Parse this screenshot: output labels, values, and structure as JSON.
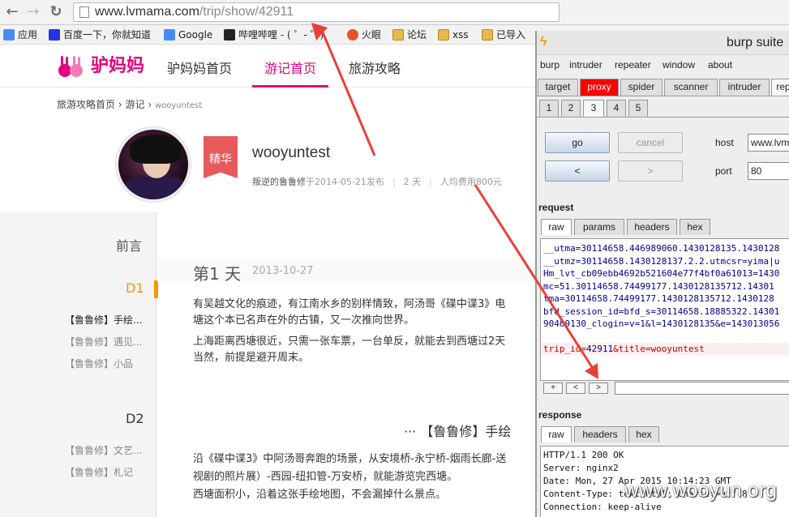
{
  "browser": {
    "url_host": "www.lvmama.com",
    "url_path": "/trip/show/42911",
    "bookmarks": [
      {
        "label": "应用",
        "icon": "apps-icon"
      },
      {
        "label": "百度一下，你就知道",
        "icon": "baidu-icon"
      },
      {
        "label": "Google",
        "icon": "google-icon"
      },
      {
        "label": "哔哩哔哩 - ( ゜- ゜)",
        "icon": "bilibili-icon"
      },
      {
        "label": "火眼",
        "icon": "fireeye-icon"
      },
      {
        "label": "论坛",
        "icon": "folder-icon"
      },
      {
        "label": "xss",
        "icon": "folder-icon"
      },
      {
        "label": "已导入",
        "icon": "folder-icon"
      }
    ]
  },
  "site": {
    "logo_text": "驴妈妈",
    "nav": [
      "驴妈妈首页",
      "游记首页",
      "旅游攻略"
    ],
    "nav_active": "游记首页",
    "breadcrumb": [
      "旅游攻略首页",
      "游记",
      "wooyuntest"
    ],
    "breadcrumb_sep": "›",
    "badge": "精华",
    "trip_title": "wooyuntest",
    "author": "叛逆的鲁鲁修",
    "published": "于2014-05-21发布",
    "days": "2 天",
    "avg_cost": "人均费用800元"
  },
  "sidebar": {
    "preface": "前言",
    "d1": "D1",
    "d1_items": [
      "【鲁鲁修】手绘...",
      "【鲁鲁修】遇见...",
      "【鲁鲁修】小品"
    ],
    "d2": "D2",
    "d2_items": [
      "【鲁鲁修】文艺...",
      "【鲁鲁修】札记"
    ]
  },
  "article": {
    "day_title": "第1 天",
    "day_date": "2013-10-27",
    "paragraphs_1": [
      "有吴越文化的痕迹，有江南水乡的别样情致，阿汤哥《碟中谍3》电",
      "塘这个本已名声在外的古镇，又一次推向世界。",
      "上海距离西塘很近，只需一张车票，一台单反，就能去到西塘过2天",
      "当然，前提是避开周末。"
    ],
    "section_title": "··· 【鲁鲁修】手绘",
    "paragraphs_2": [
      "沿《碟中谍3》中阿汤哥奔跑的场景，从安境桥-永宁桥-烟雨长廊-送",
      "视剧的照片展）-西园-纽扣管-万安桥，就能游览完西塘。",
      "西塘面积小，沿着这张手绘地图，不会漏掉什么景点。"
    ]
  },
  "burp": {
    "title": "burp suite",
    "menu": [
      "burp",
      "intruder",
      "repeater",
      "window",
      "about"
    ],
    "tabs": [
      "target",
      "proxy",
      "spider",
      "scanner",
      "intruder",
      "rep"
    ],
    "repeater_tabs": [
      "1",
      "2",
      "3",
      "4",
      "5"
    ],
    "selected_repeater_tab": "3",
    "go": "go",
    "cancel": "cancel",
    "back": "<",
    "forward": ">",
    "host_label": "host",
    "host_value": "www.lvm",
    "port_label": "port",
    "port_value": "80",
    "request_label": "request",
    "request_tabs": [
      "raw",
      "params",
      "headers",
      "hex"
    ],
    "request_lines": [
      "__utma=30114658.446989060.1430128135.1430128",
      "__utmz=30114658.1430128137.2.2.utmcsr=yima|u",
      "Hm_lvt_cb09ebb4692b521604e77f4bf0a61013=1430",
      "mc=51.30114658.74499177.1430128135712.14301",
      "tma=30114658.74499177.1430128135712.1430128",
      "bfd_session_id=bfd_s=30114658.18885322.14301",
      "90409130_clogin=v=1&l=1430128135&e=143013056",
      ""
    ],
    "request_body_key": "trip_id=",
    "request_body_val": "42911",
    "request_body_rest": "&title=wooyuntest",
    "nav_buttons": [
      "+",
      "<",
      ">"
    ],
    "response_label": "response",
    "response_tabs": [
      "raw",
      "headers",
      "hex"
    ],
    "response_lines": [
      "HTTP/1.1 200 OK",
      "Server: nginx2",
      "Date: Mon, 27 Apr 2015 10:14:23 GMT",
      "Content-Type: text/html; charset=utf-8",
      "Connection: keep-alive"
    ]
  },
  "watermark": "www.wooyun.org",
  "colors": {
    "brand": "#e4007f",
    "day_accent": "#f39800",
    "annotation_arrow": "#e8413a"
  }
}
